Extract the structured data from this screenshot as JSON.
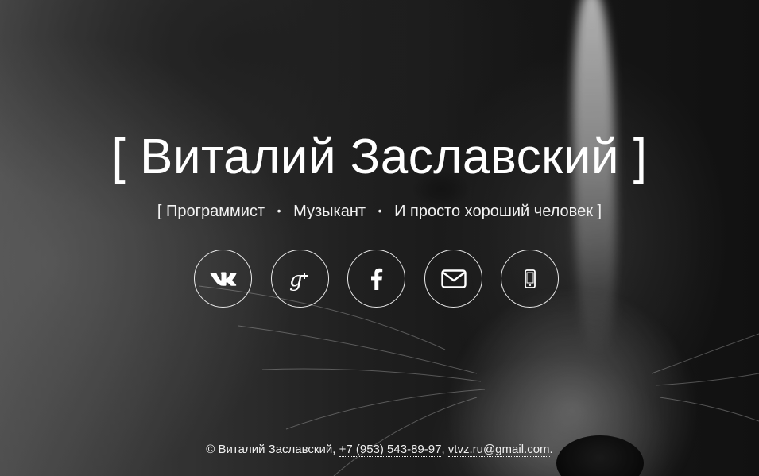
{
  "header": {
    "title": "[ Виталий Заславский ]"
  },
  "tagline": {
    "open_bracket": "[",
    "items": [
      "Программист",
      "Музыкант",
      "И просто хороший человек"
    ],
    "separator": "•",
    "close_bracket": "]"
  },
  "social_links": [
    {
      "name": "vk",
      "icon": "vk-icon"
    },
    {
      "name": "google-plus",
      "icon": "google-plus-icon"
    },
    {
      "name": "facebook",
      "icon": "facebook-icon"
    },
    {
      "name": "email",
      "icon": "envelope-icon"
    },
    {
      "name": "phone",
      "icon": "mobile-phone-icon"
    }
  ],
  "footer": {
    "copyright": "© Виталий Заславский,",
    "phone": "+7 (953) 543-89-97",
    "comma": ",",
    "email": "vtvz.ru@gmail.com",
    "period": "."
  },
  "colors": {
    "text": "#ffffff",
    "background": "#1a1a1a"
  }
}
